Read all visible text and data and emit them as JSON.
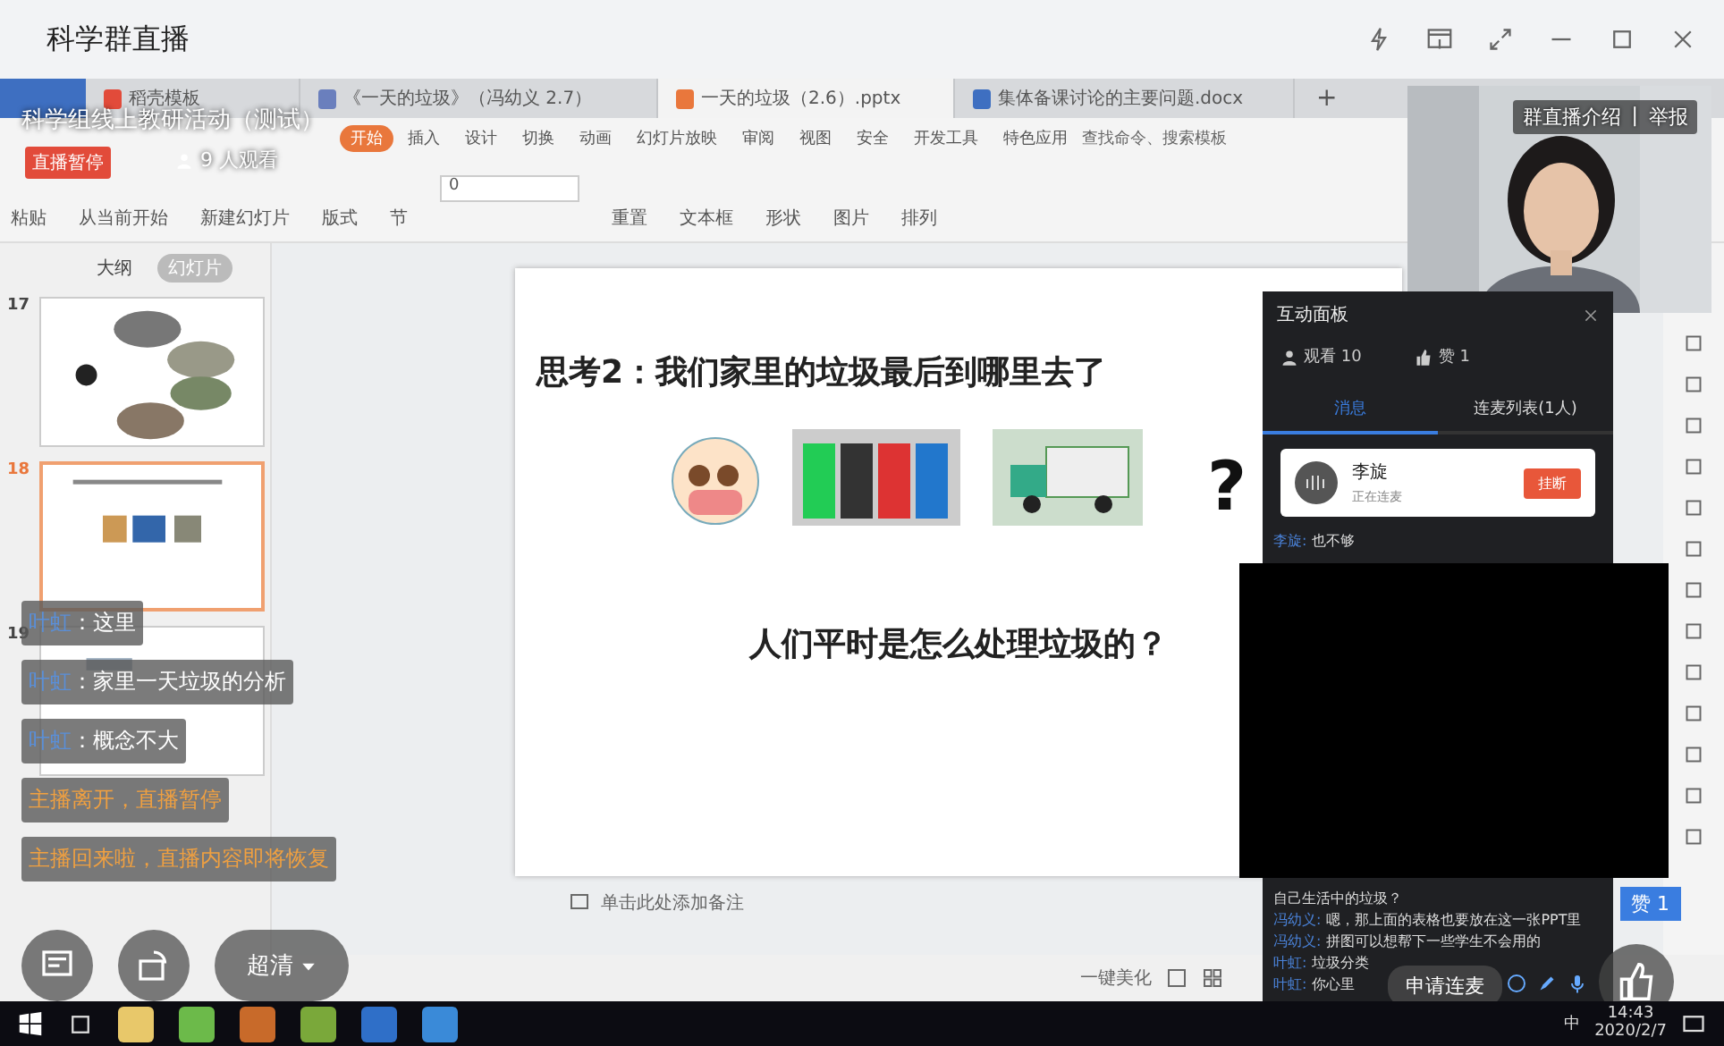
{
  "window": {
    "title": "科学群直播"
  },
  "stream": {
    "title": "科学组线上教研活动（测试）",
    "status_badge": "直播暂停",
    "viewers": "9 人观看",
    "links": [
      "群直播介绍",
      "举报"
    ],
    "separator": "|"
  },
  "shared_screen": {
    "tabs": [
      {
        "label": "稻壳模板",
        "selected": false
      },
      {
        "label": "《一天的垃圾》（冯幼义 2.7）",
        "selected": false
      },
      {
        "label": "一天的垃圾（2.6）.pptx",
        "selected": true
      },
      {
        "label": "集体备课讨论的主要问题.docx",
        "selected": false
      }
    ],
    "new_tab": "+",
    "menu": [
      {
        "label": "开始",
        "selected": true
      },
      {
        "label": "插入",
        "selected": false
      },
      {
        "label": "设计",
        "selected": false
      },
      {
        "label": "切换",
        "selected": false
      },
      {
        "label": "动画",
        "selected": false
      },
      {
        "label": "幻灯片放映",
        "selected": false
      },
      {
        "label": "审阅",
        "selected": false
      },
      {
        "label": "视图",
        "selected": false
      },
      {
        "label": "安全",
        "selected": false
      },
      {
        "label": "开发工具",
        "selected": false
      },
      {
        "label": "特色应用",
        "selected": false
      }
    ],
    "search": "查找命令、搜索模板",
    "toolbar": [
      "粘贴",
      "从当前开始",
      "新建幻灯片",
      "版式",
      "节",
      "重置",
      "文本框",
      "形状",
      "图片",
      "排列"
    ],
    "font_size": "0",
    "slide_panel": {
      "tabs": [
        {
          "label": "大纲",
          "selected": false
        },
        {
          "label": "幻灯片",
          "selected": true
        }
      ],
      "slides": [
        {
          "number": "17",
          "selected": false
        },
        {
          "number": "18",
          "selected": true
        },
        {
          "number": "19",
          "selected": false
        }
      ]
    },
    "slide": {
      "title": "思考2：我们家里的垃圾最后到哪里去了",
      "mark": "?",
      "question": "人们平时是怎么处理垃圾的？"
    },
    "notes": "单击此处添加备注",
    "beautify": "一键美化"
  },
  "chat_overlay": [
    {
      "kind": "user",
      "name": "叶虹",
      "text": "：这里"
    },
    {
      "kind": "user",
      "name": "叶虹",
      "text": "：家里一天垃圾的分析"
    },
    {
      "kind": "user",
      "name": "叶虹",
      "text": "：概念不大"
    },
    {
      "kind": "system",
      "text": "主播离开，直播暂停"
    },
    {
      "kind": "system",
      "text": "主播回来啦，直播内容即将恢复"
    }
  ],
  "controls": {
    "quality": "超清"
  },
  "panel": {
    "title": "互动面板",
    "watchers": "观看 10",
    "likes": "赞 1",
    "tabs": [
      {
        "label": "消息",
        "selected": true
      },
      {
        "label": "连麦列表(1人)",
        "selected": false
      }
    ],
    "guest": {
      "name": "李旋",
      "status": "正在连麦",
      "action": "挂断"
    },
    "messages_top": [
      {
        "name": "李旋:",
        "text": "也不够"
      }
    ],
    "messages": [
      {
        "text": "自己生活中的垃圾？"
      },
      {
        "name": "冯幼义:",
        "text": "嗯，那上面的表格也要放在这一张PPT里"
      },
      {
        "name": "冯幼义:",
        "text": "拼图可以想帮下一些学生不会用的"
      },
      {
        "name": "叶虹:",
        "text": "垃圾分类"
      },
      {
        "name": "叶虹:",
        "text": "你心里"
      }
    ],
    "like_badge": "赞 1",
    "apply": "申请连麦"
  },
  "taskbar": {
    "ime": "中",
    "time": "14:43",
    "date": "2020/2/7"
  }
}
